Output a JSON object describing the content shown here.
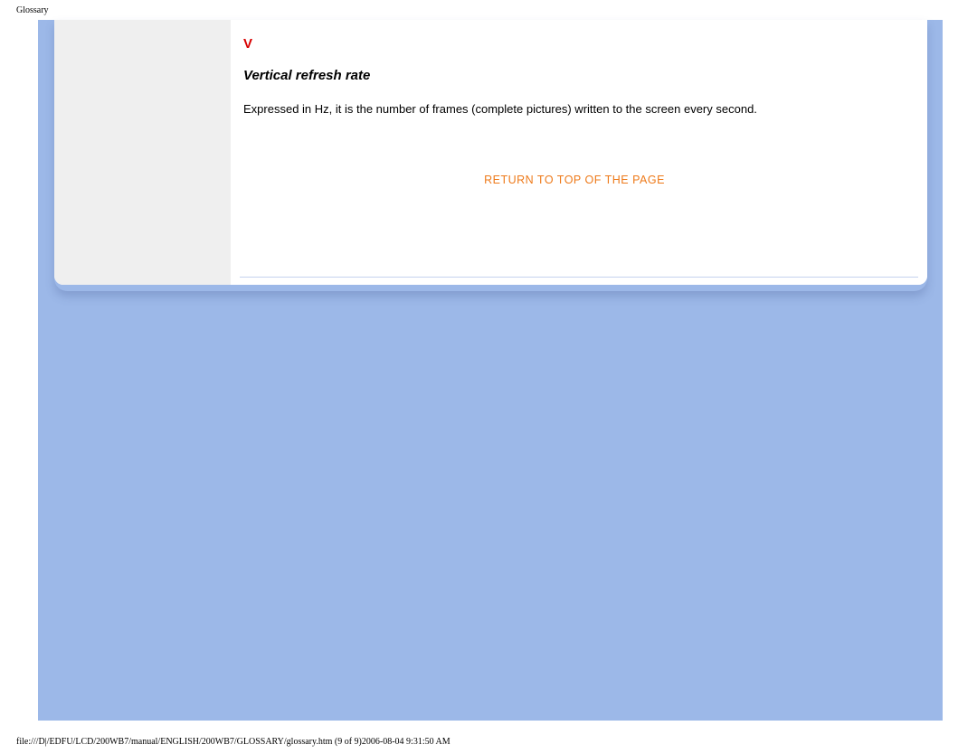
{
  "header": {
    "label": "Glossary"
  },
  "content": {
    "section_letter": "V",
    "term_title": "Vertical refresh rate",
    "term_body": "Expressed in Hz, it is the number of frames (complete pictures) written to the screen every second.",
    "return_link": "RETURN TO TOP OF THE PAGE"
  },
  "footer": {
    "text": "file:///D|/EDFU/LCD/200WB7/manual/ENGLISH/200WB7/GLOSSARY/glossary.htm (9 of 9)2006-08-04 9:31:50 AM"
  }
}
